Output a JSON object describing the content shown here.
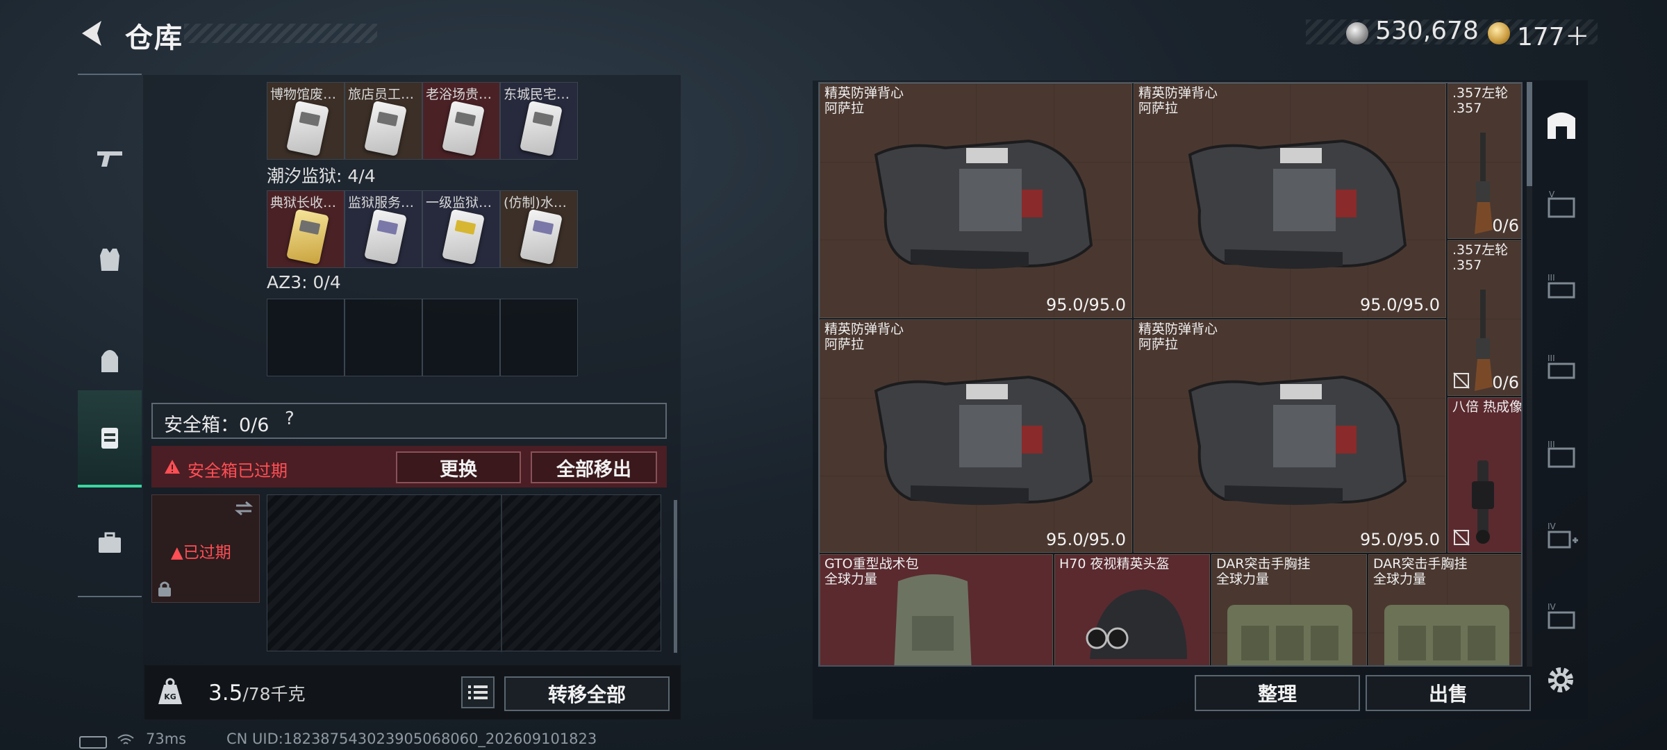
{
  "header": {
    "title": "仓库",
    "silver": "530,678",
    "gold": "177＋"
  },
  "left_nav": {
    "items": [
      "weapon",
      "vest",
      "backpack",
      "container",
      "case"
    ]
  },
  "containers": {
    "row1": [
      "博物馆废…",
      "旅店员工…",
      "老浴场贵…",
      "东城民宅…"
    ],
    "section2_label": "潮汐监狱: 4/4",
    "row2": [
      "典狱长收…",
      "监狱服务…",
      "一级监狱…",
      "(仿制)水…"
    ],
    "section3_label": "AZ3: 0/4"
  },
  "safebox": {
    "title": "安全箱：0/6",
    "help": "?",
    "expired_warning": "安全箱已过期",
    "replace_label": "更换",
    "remove_all_label": "全部移出",
    "expired_badge": "已过期"
  },
  "footer_left": {
    "weight_value": "3.5",
    "weight_max": "/78千克",
    "transfer_label": "转移全部"
  },
  "status": {
    "ping": "73ms",
    "uid": "CN UID:182387543023905068060_202609101823"
  },
  "stash_items": [
    {
      "name": "精英防弹背心",
      "sub": "阿萨拉",
      "durability": "95.0/95.0"
    },
    {
      "name": "精英防弹背心",
      "sub": "阿萨拉",
      "durability": "95.0/95.0"
    },
    {
      "name": "精英防弹背心",
      "sub": "阿萨拉",
      "durability": "95.0/95.0"
    },
    {
      "name": "精英防弹背心",
      "sub": "阿萨拉",
      "durability": "95.0/95.0"
    },
    {
      "name": ".357左轮",
      "sub": ".357",
      "count": "0/6"
    },
    {
      "name": ".357左轮",
      "sub": ".357",
      "count": "0/6"
    },
    {
      "name": "八倍 热成像"
    },
    {
      "name": "GTO重型战术包",
      "sub": "全球力量"
    },
    {
      "name": "H70 夜视精英头盔"
    },
    {
      "name": "DAR突击手胸挂",
      "sub": "全球力量"
    },
    {
      "name": "DAR突击手胸挂",
      "sub": "全球力量"
    }
  ],
  "right_footer": {
    "sort_label": "整理",
    "sell_label": "出售"
  },
  "right_tabs": [
    "stash",
    "V",
    "III",
    "III",
    "III",
    "IV",
    "IV"
  ]
}
